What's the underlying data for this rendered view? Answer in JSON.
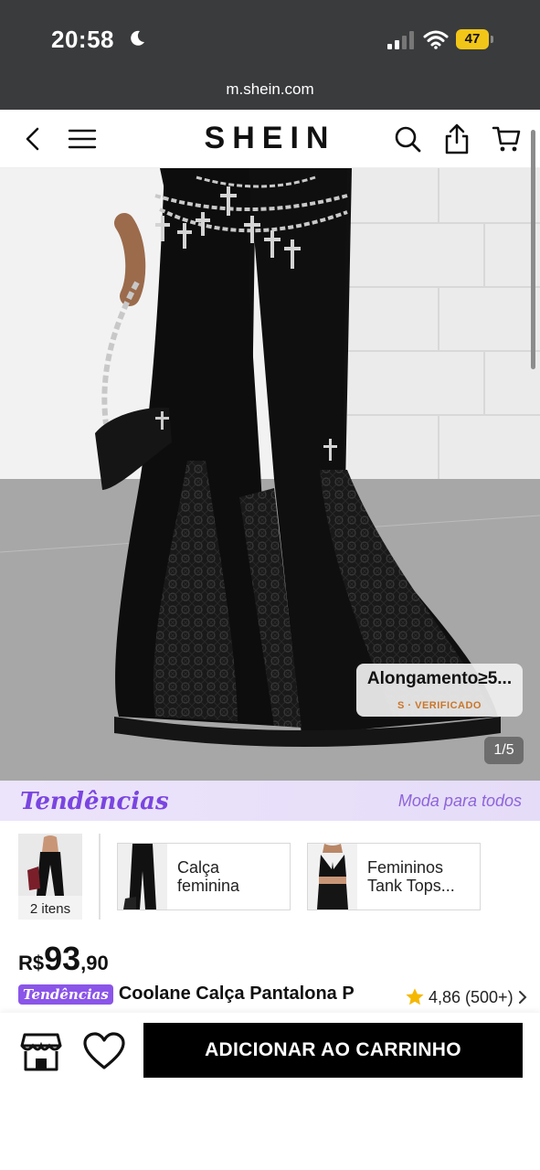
{
  "status_bar": {
    "time": "20:58",
    "battery": "47"
  },
  "browser": {
    "url": "m.shein.com"
  },
  "nav": {
    "logo": "SHEIN",
    "icons": [
      "back-icon",
      "menu-icon",
      "search-icon",
      "share-icon",
      "cart-icon"
    ]
  },
  "gallery": {
    "tag_title": "Alongamento≥5...",
    "tag_subtitle": "S · VERIFICADO",
    "counter": "1/5"
  },
  "trends": {
    "logo": "Tendências",
    "slogan": "Moda para todos",
    "first_item_label": "2 itens",
    "cards": [
      {
        "label": "Calça feminina"
      },
      {
        "label": "Femininos Tank Tops..."
      }
    ]
  },
  "product": {
    "currency": "R$",
    "price_int": "93",
    "price_dec": ",90",
    "badge": "Tendências",
    "title": "Coolane Calça Pantalona P",
    "rating": "4,86 (500+)"
  },
  "actions": {
    "add_to_cart": "ADICIONAR AO CARRINHO"
  },
  "colors": {
    "status_bar_bg": "#3a3b3d",
    "battery": "#f2c618",
    "trend_purple": "#7a45e0",
    "star": "#f5b800",
    "cart_button": "#000000"
  }
}
